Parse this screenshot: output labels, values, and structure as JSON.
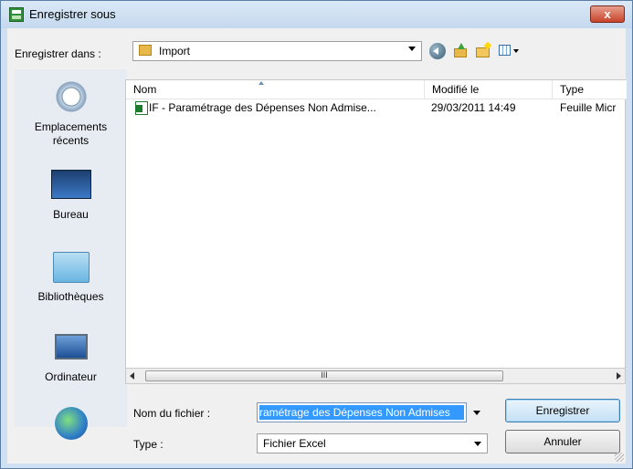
{
  "window": {
    "title": "Enregistrer sous",
    "close_label": "x"
  },
  "toolbar": {
    "save_in_label": "Enregistrer dans :",
    "location": "Import",
    "icons": [
      "back-icon",
      "up-folder-icon",
      "new-folder-icon",
      "views-menu-icon"
    ]
  },
  "places": [
    {
      "label": "Emplacements récents",
      "icon": "recent-places-icon"
    },
    {
      "label": "Bureau",
      "icon": "desktop-icon"
    },
    {
      "label": "Bibliothèques",
      "icon": "libraries-icon"
    },
    {
      "label": "Ordinateur",
      "icon": "computer-icon"
    },
    {
      "label": "",
      "icon": "network-icon"
    }
  ],
  "filelist": {
    "columns": [
      "Nom",
      "Modifié le",
      "Type"
    ],
    "rows": [
      {
        "name": "IF - Paramétrage des Dépenses Non Admise...",
        "modified": "29/03/2011 14:49",
        "type": "Feuille Micr"
      }
    ],
    "scroll_thumb_glyph": "III"
  },
  "form": {
    "filename_label": "Nom du fichier :",
    "filename_value": "Paramétrage des Dépenses Non Admises",
    "filename_shown": "ramétrage des Dépenses Non Admises",
    "type_label": "Type :",
    "type_value": "Fichier Excel"
  },
  "buttons": {
    "save": "Enregistrer",
    "cancel": "Annuler"
  },
  "colors": {
    "title_bar": "#c4d8ee",
    "close_button": "#c8442a",
    "selection": "#3399ff",
    "places_bg": "#e7ecf3",
    "excel_green": "#1e7a2c"
  }
}
